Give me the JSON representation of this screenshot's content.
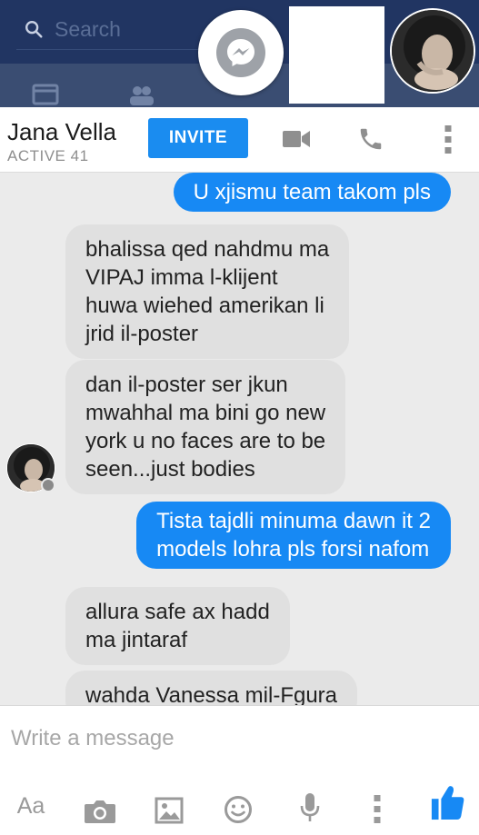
{
  "topbar": {
    "search_placeholder": "Search"
  },
  "chat": {
    "contact_name": "Jana Vella",
    "status": "ACTIVE 41",
    "invite_label": "INVITE"
  },
  "messages": [
    {
      "dir": "out",
      "lines": [
        "U xjismu team takom pls"
      ]
    },
    {
      "dir": "in",
      "lines": [
        "bhalissa qed nahdmu ma",
        "VIPAJ imma l-klijent",
        "huwa wiehed amerikan li",
        "jrid il-poster"
      ]
    },
    {
      "dir": "in",
      "lines": [
        "dan il-poster ser jkun",
        "mwahhal ma bini go new",
        "york u no faces are to be",
        "seen...just bodies"
      ]
    },
    {
      "dir": "out",
      "lines": [
        "Tista tajdli minuma dawn it 2",
        "models lohra pls forsi nafom"
      ]
    },
    {
      "dir": "in",
      "lines": [
        "allura safe ax hadd",
        "ma jintaraf"
      ]
    },
    {
      "dir": "in",
      "lines": [
        "wahda Vanessa mil-Fgura"
      ]
    }
  ],
  "composer": {
    "placeholder": "Write a message",
    "text_tool_label": "Aa"
  },
  "colors": {
    "facebook_navy": "#213562",
    "messenger_blue": "#1789f4",
    "invite_blue": "#1a8cf0",
    "incoming_bubble": "#e0e0e0"
  },
  "icons": [
    "search-icon",
    "messenger-icon",
    "video-call-icon",
    "phone-icon",
    "more-vertical-icon",
    "camera-icon",
    "image-icon",
    "emoji-icon",
    "microphone-icon",
    "like-icon"
  ]
}
